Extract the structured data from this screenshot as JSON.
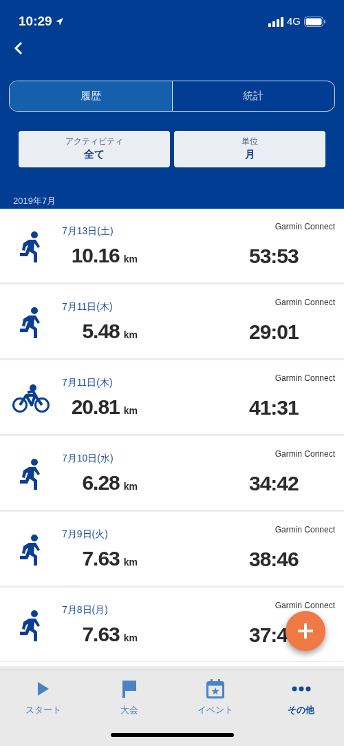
{
  "status_bar": {
    "time": "10:29",
    "network": "4G"
  },
  "tabs": [
    {
      "label": "履歴",
      "selected": true
    },
    {
      "label": "統計",
      "selected": false
    }
  ],
  "filters": [
    {
      "label": "アクティビティ",
      "value": "全て"
    },
    {
      "label": "単位",
      "value": "月"
    }
  ],
  "month": "2019年7月",
  "activities": [
    {
      "kind": "run",
      "date": "7月13日(土)",
      "distance": "10.16",
      "unit": "km",
      "source": "Garmin Connect",
      "duration": "53:53"
    },
    {
      "kind": "run",
      "date": "7月11日(木)",
      "distance": "5.48",
      "unit": "km",
      "source": "Garmin Connect",
      "duration": "29:01"
    },
    {
      "kind": "bike",
      "date": "7月11日(木)",
      "distance": "20.81",
      "unit": "km",
      "source": "Garmin Connect",
      "duration": "41:31"
    },
    {
      "kind": "run",
      "date": "7月10日(水)",
      "distance": "6.28",
      "unit": "km",
      "source": "Garmin Connect",
      "duration": "34:42"
    },
    {
      "kind": "run",
      "date": "7月9日(火)",
      "distance": "7.63",
      "unit": "km",
      "source": "Garmin Connect",
      "duration": "38:46"
    },
    {
      "kind": "run",
      "date": "7月8日(月)",
      "distance": "7.63",
      "unit": "km",
      "source": "Garmin Connect",
      "duration": "37:4"
    }
  ],
  "nav": [
    {
      "kind": "start",
      "label": "スタート",
      "selected": false
    },
    {
      "kind": "race",
      "label": "大会",
      "selected": false
    },
    {
      "kind": "event",
      "label": "イベント",
      "selected": false
    },
    {
      "kind": "more",
      "label": "その他",
      "selected": true
    }
  ]
}
